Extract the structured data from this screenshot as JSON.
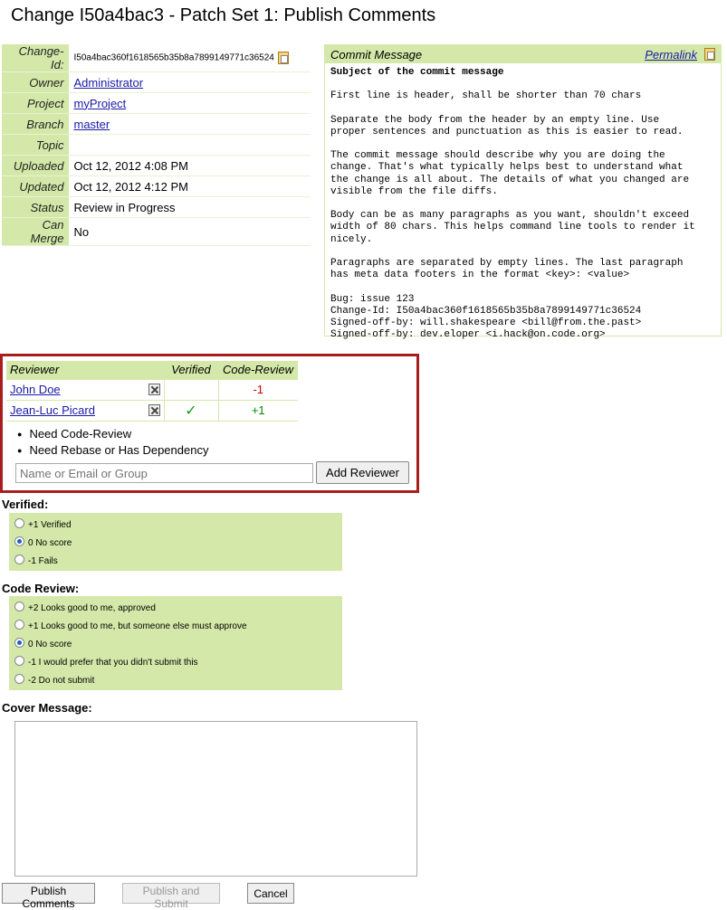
{
  "page_title": "Change I50a4bac3 - Patch Set 1: Publish Comments",
  "info": [
    {
      "label": "Change-Id:",
      "value": "I50a4bac360f1618565b35b8a7899149771c36524",
      "link": false,
      "copy": true
    },
    {
      "label": "Owner",
      "value": "Administrator",
      "link": true
    },
    {
      "label": "Project",
      "value": "myProject",
      "link": true
    },
    {
      "label": "Branch",
      "value": "master",
      "link": true
    },
    {
      "label": "Topic",
      "value": "",
      "link": false
    },
    {
      "label": "Uploaded",
      "value": "Oct 12, 2012 4:08 PM",
      "link": false
    },
    {
      "label": "Updated",
      "value": "Oct 12, 2012 4:12 PM",
      "link": false
    },
    {
      "label": "Status",
      "value": "Review in Progress",
      "link": false
    },
    {
      "label": "Can Merge",
      "value": "No",
      "link": false
    }
  ],
  "commit": {
    "heading": "Commit Message",
    "permalink": "Permalink",
    "subject": "Subject of the commit message",
    "body": "First line is header, shall be shorter than 70 chars\n\nSeparate the body from the header by an empty line. Use\nproper sentences and punctuation as this is easier to read.\n\nThe commit message should describe why you are doing the\nchange. That's what typically helps best to understand what\nthe change is all about. The details of what you changed are\nvisible from the file diffs.\n\nBody can be as many paragraphs as you want, shouldn't exceed\nwidth of 80 chars. This helps command line tools to render it\nnicely.\n\nParagraphs are separated by empty lines. The last paragraph\nhas meta data footers in the format <key>: <value>\n\nBug: issue 123\nChange-Id: I50a4bac360f1618565b35b8a7899149771c36524\nSigned-off-by: will.shakespeare <bill@from.the.past>\nSigned-off-by: dev.eloper <i.hack@on.code.org>"
  },
  "reviewers": {
    "headers": [
      "Reviewer",
      "Verified",
      "Code-Review"
    ],
    "rows": [
      {
        "name": "John Doe",
        "verified": "",
        "code_review": "-1"
      },
      {
        "name": "Jean-Luc Picard",
        "verified": "✓",
        "code_review": "+1"
      }
    ],
    "needs": [
      "Need Code-Review",
      "Need Rebase or Has Dependency"
    ],
    "input_placeholder": "Name or Email or Group",
    "add_button": "Add Reviewer"
  },
  "verified": {
    "label": "Verified:",
    "options": [
      {
        "text": "+1 Verified",
        "selected": false
      },
      {
        "text": "0 No score",
        "selected": true
      },
      {
        "text": "-1 Fails",
        "selected": false
      }
    ]
  },
  "code_review": {
    "label": "Code Review:",
    "options": [
      {
        "text": "+2 Looks good to me, approved",
        "selected": false
      },
      {
        "text": "+1 Looks good to me, but someone else must approve",
        "selected": false
      },
      {
        "text": "0 No score",
        "selected": true
      },
      {
        "text": "-1 I would prefer that you didn't submit this",
        "selected": false
      },
      {
        "text": "-2 Do not submit",
        "selected": false
      }
    ]
  },
  "cover_label": "Cover Message:",
  "buttons": {
    "publish": "Publish Comments",
    "publish_submit": "Publish and Submit",
    "cancel": "Cancel"
  }
}
